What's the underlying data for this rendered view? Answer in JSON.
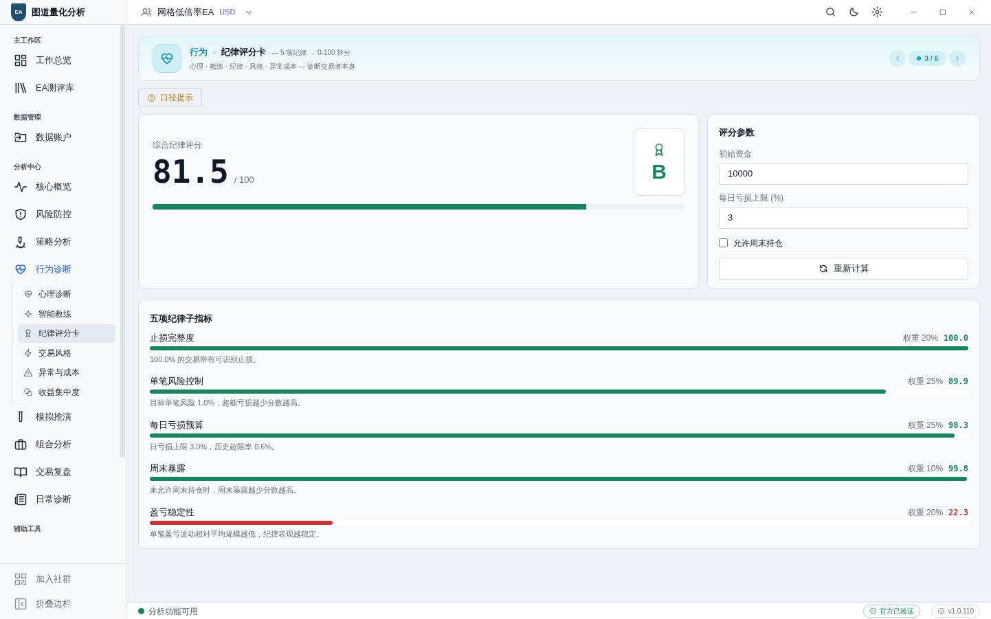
{
  "app": {
    "title": "图道量化分析",
    "logo_text": "EA"
  },
  "header": {
    "account": "网格低倍率EA",
    "currency": "USD"
  },
  "sidebar": {
    "sections": [
      {
        "title": "主工作区",
        "items": [
          {
            "label": "工作总览",
            "selected": false
          },
          {
            "label": "EA测评库",
            "selected": false
          }
        ]
      },
      {
        "title": "数据管理",
        "items": [
          {
            "label": "数据账户",
            "selected": false
          }
        ]
      },
      {
        "title": "分析中心",
        "items": [
          {
            "label": "核心概览",
            "selected": false
          },
          {
            "label": "风险防控",
            "selected": false
          },
          {
            "label": "策略分析",
            "selected": false
          },
          {
            "label": "行为诊断",
            "selected": true,
            "children": [
              {
                "label": "心理诊断",
                "selected": false
              },
              {
                "label": "智能教练",
                "selected": false
              },
              {
                "label": "纪律评分卡",
                "selected": true
              },
              {
                "label": "交易风格",
                "selected": false
              },
              {
                "label": "异常与成本",
                "selected": false
              },
              {
                "label": "收益集中度",
                "selected": false
              }
            ]
          },
          {
            "label": "模拟推演",
            "selected": false
          },
          {
            "label": "组合分析",
            "selected": false
          },
          {
            "label": "交易复盘",
            "selected": false
          },
          {
            "label": "日常诊断",
            "selected": false
          }
        ]
      },
      {
        "title": "辅助工具"
      }
    ],
    "footer_items": [
      {
        "label": "加入社群"
      },
      {
        "label": "折叠边栏"
      }
    ]
  },
  "banner": {
    "category": "行为",
    "separator": "·",
    "title": "纪律评分卡",
    "summary": "— 5 项纪律 → 0-100 评分",
    "subtitle": "心理 · 教练 · 纪律 · 风格 · 异常成本 — 诊断交易者本身",
    "pager": "3 / 6"
  },
  "hint_button": "口径提示",
  "score_card": {
    "label": "综合纪律评分",
    "score": "81.5",
    "max": "/ 100",
    "grade": "B",
    "level": 0.815
  },
  "params": {
    "title": "评分参数",
    "fields": [
      {
        "label": "初始资金",
        "value": "10000"
      },
      {
        "label": "每日亏损上限 (%)",
        "value": "3"
      }
    ],
    "checkbox": {
      "label": "允许周末持仓",
      "checked": false
    },
    "button": "重新计算"
  },
  "metrics": {
    "title": "五项纪律子指标",
    "items": [
      {
        "name": "止损完整度",
        "weight": "权重 20%",
        "score": "100.0",
        "level": 1.0,
        "color": "#15875f",
        "note": "100.0% 的交易带有可识别止损。"
      },
      {
        "name": "单笔风险控制",
        "weight": "权重 25%",
        "score": "89.9",
        "level": 0.899,
        "color": "#15875f",
        "note": "目标单笔风险 1.0%，超额亏损越少分数越高。"
      },
      {
        "name": "每日亏损预算",
        "weight": "权重 25%",
        "score": "98.3",
        "level": 0.983,
        "color": "#15875f",
        "note": "日亏损上限 3.0%，历史超限率 0.6%。"
      },
      {
        "name": "周末暴露",
        "weight": "权重 10%",
        "score": "99.8",
        "level": 0.998,
        "color": "#15875f",
        "note": "未允许周末持仓时，周末暴露越少分数越高。"
      },
      {
        "name": "盈亏稳定性",
        "weight": "权重 20%",
        "score": "22.3",
        "level": 0.223,
        "color": "#c93333",
        "note": "单笔盈亏波动相对平均规模越低，纪律表现越稳定。"
      }
    ]
  },
  "status_bar": {
    "status": "分析功能可用",
    "verified": "官方已验证",
    "version": "v1.0.110"
  }
}
